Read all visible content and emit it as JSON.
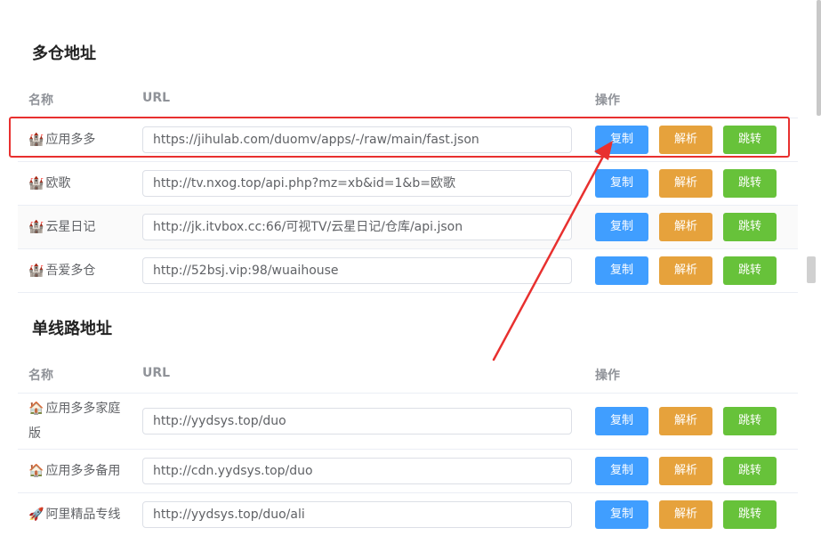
{
  "sections": [
    {
      "title": "多仓地址",
      "headers": {
        "name": "名称",
        "url": "URL",
        "actions": "操作"
      },
      "rows": [
        {
          "icon": "🏰",
          "name": "应用多多",
          "url": "https://jihulab.com/duomv/apps/-/raw/main/fast.json"
        },
        {
          "icon": "🏰",
          "name": "欧歌",
          "url": "http://tv.nxog.top/api.php?mz=xb&id=1&b=欧歌"
        },
        {
          "icon": "🏰",
          "name": "云星日记",
          "url": "http://jk.itvbox.cc:66/可视TV/云星日记/仓库/api.json"
        },
        {
          "icon": "🏰",
          "name": "吾爱多仓",
          "url": "http://52bsj.vip:98/wuaihouse"
        }
      ]
    },
    {
      "title": "单线路地址",
      "headers": {
        "name": "名称",
        "url": "URL",
        "actions": "操作"
      },
      "rows": [
        {
          "icon": "🏠",
          "name": "应用多多家庭版",
          "url": "http://yydsys.top/duo"
        },
        {
          "icon": "🏠",
          "name": "应用多多备用",
          "url": "http://cdn.yydsys.top/duo"
        },
        {
          "icon": "🚀",
          "name": "阿里精品专线",
          "url": "http://yydsys.top/duo/ali"
        }
      ]
    }
  ],
  "buttons": {
    "copy": "复制",
    "parse": "解析",
    "jump": "跳转"
  },
  "colors": {
    "copy": "#409eff",
    "parse": "#e6a23c",
    "jump": "#67c23a",
    "highlight": "#e8302f"
  }
}
